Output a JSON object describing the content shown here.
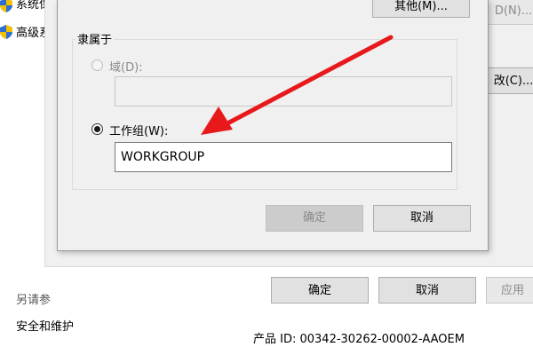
{
  "background_window": {
    "sidebar": {
      "item_1": "系统保",
      "item_2": "高级系"
    },
    "right_buttons": {
      "button_1": "D(N)...",
      "button_2": "改(C)..."
    },
    "footer": {
      "see_also": "另请参",
      "security_link": "安全和维护",
      "product_id": "产品 ID: 00342-30262-00002-AAOEM"
    },
    "buttons": {
      "ok": "确定",
      "cancel": "取消",
      "apply": "应用"
    }
  },
  "dialog": {
    "top_button": "其他(M)...",
    "member_of_title": "隶属于",
    "domain": {
      "label": "域(D):",
      "value": "",
      "selected": false,
      "enabled": false
    },
    "workgroup": {
      "label": "工作组(W):",
      "value": "WORKGROUP",
      "selected": true,
      "enabled": true
    },
    "buttons": {
      "ok": "确定",
      "cancel": "取消"
    }
  },
  "annotation": {
    "arrow_color": "#e8191b"
  }
}
